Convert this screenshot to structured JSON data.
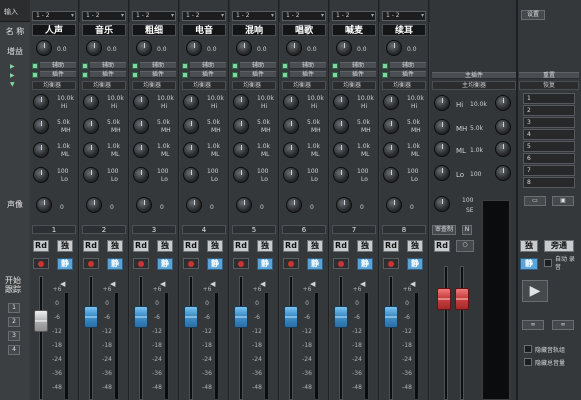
{
  "top": {
    "input_label": "输入",
    "right_button": "设置"
  },
  "left_labels": {
    "name": "名 称",
    "gain": "增益",
    "pan": "声像",
    "start_follow": "开始 跟踪",
    "left_nums": [
      "1",
      "2",
      "3",
      "4"
    ]
  },
  "channels": [
    {
      "input": "1 - 2",
      "name": "人声",
      "gain": "0.0",
      "send": "辅助",
      "insert": "插件",
      "eq": "均衡器",
      "hi_f": "10.0k",
      "hi_l": "Hi",
      "mh_f": "5.0k",
      "mh_l": "MH",
      "ml_f": "1.0k",
      "ml_l": "ML",
      "lo_f": "100",
      "lo_l": "Lo",
      "pan": "0",
      "num": "1",
      "rd": "Rd",
      "solo": "独",
      "mute": "静"
    },
    {
      "input": "1 - 2",
      "name": "音乐",
      "gain": "0.0",
      "send": "辅助",
      "insert": "插件",
      "eq": "均衡器",
      "hi_f": "10.0k",
      "hi_l": "Hi",
      "mh_f": "5.0k",
      "mh_l": "MH",
      "ml_f": "1.0k",
      "ml_l": "ML",
      "lo_f": "100",
      "lo_l": "Lo",
      "pan": "0",
      "num": "2",
      "rd": "Rd",
      "solo": "独",
      "mute": "静"
    },
    {
      "input": "1 - 2",
      "name": "粗细",
      "gain": "0.0",
      "send": "辅助",
      "insert": "插件",
      "eq": "均衡器",
      "hi_f": "10.0k",
      "hi_l": "Hi",
      "mh_f": "5.0k",
      "mh_l": "MH",
      "ml_f": "1.0k",
      "ml_l": "ML",
      "lo_f": "100",
      "lo_l": "Lo",
      "pan": "0",
      "num": "3",
      "rd": "Rd",
      "solo": "独",
      "mute": "静"
    },
    {
      "input": "1 - 2",
      "name": "电音",
      "gain": "0.0",
      "send": "辅助",
      "insert": "插件",
      "eq": "均衡器",
      "hi_f": "10.0k",
      "hi_l": "Hi",
      "mh_f": "5.0k",
      "mh_l": "MH",
      "ml_f": "1.0k",
      "ml_l": "ML",
      "lo_f": "100",
      "lo_l": "Lo",
      "pan": "0",
      "num": "4",
      "rd": "Rd",
      "solo": "独",
      "mute": "静"
    },
    {
      "input": "1 - 2",
      "name": "混响",
      "gain": "0.0",
      "send": "辅助",
      "insert": "插件",
      "eq": "均衡器",
      "hi_f": "10.0k",
      "hi_l": "Hi",
      "mh_f": "5.0k",
      "mh_l": "MH",
      "ml_f": "1.0k",
      "ml_l": "ML",
      "lo_f": "100",
      "lo_l": "Lo",
      "pan": "0",
      "num": "5",
      "rd": "Rd",
      "solo": "独",
      "mute": "静"
    },
    {
      "input": "1 - 2",
      "name": "唱歌",
      "gain": "0.0",
      "send": "辅助",
      "insert": "插件",
      "eq": "均衡器",
      "hi_f": "10.0k",
      "hi_l": "Hi",
      "mh_f": "5.0k",
      "mh_l": "MH",
      "ml_f": "1.0k",
      "ml_l": "ML",
      "lo_f": "100",
      "lo_l": "Lo",
      "pan": "0",
      "num": "6",
      "rd": "Rd",
      "solo": "独",
      "mute": "静"
    },
    {
      "input": "1 - 2",
      "name": "喊麦",
      "gain": "0.0",
      "send": "辅助",
      "insert": "插件",
      "eq": "均衡器",
      "hi_f": "10.0k",
      "hi_l": "Hi",
      "mh_f": "5.0k",
      "mh_l": "MH",
      "ml_f": "1.0k",
      "ml_l": "ML",
      "lo_f": "100",
      "lo_l": "Lo",
      "pan": "0",
      "num": "7",
      "rd": "Rd",
      "solo": "独",
      "mute": "静"
    },
    {
      "input": "1 - 2",
      "name": "续耳",
      "gain": "0.0",
      "send": "辅助",
      "insert": "插件",
      "eq": "均衡器",
      "hi_f": "10.0k",
      "hi_l": "Hi",
      "mh_f": "5.0k",
      "mh_l": "MH",
      "ml_f": "1.0k",
      "ml_l": "ML",
      "lo_f": "100",
      "lo_l": "Lo",
      "pan": "0",
      "num": "8",
      "rd": "Rd",
      "solo": "独",
      "mute": "静"
    }
  ],
  "master": {
    "insert": "主插件",
    "eq": "主均衡器",
    "hi_l": "Hi",
    "hi_f": "10.0k",
    "mh_l": "MH",
    "mh_f": "5.0k",
    "ml_l": "ML",
    "ml_f": "1.0k",
    "lo_l": "Lo",
    "lo_f": "100",
    "pan": "100",
    "pan_l": "SE",
    "rd": "Rd",
    "btn": "审查制"
  },
  "right_panel": {
    "reset": "重置",
    "recover": "恢复",
    "slots": [
      "1",
      "2",
      "3",
      "4",
      "5",
      "6",
      "7",
      "8"
    ],
    "solo": "独",
    "return": "旁通",
    "mute": "静",
    "auto_rec": "自动 录音",
    "hide_tracks": "隐藏音轨组",
    "hide_master": "隐藏总音量"
  },
  "fader_scale": [
    "+6",
    "0",
    "-6",
    "-12",
    "-18",
    "-24",
    "-36",
    "-48"
  ],
  "colors": {
    "accent": "#5aa4d8",
    "led": "#7fd6a0",
    "rec": "#cc3333"
  }
}
